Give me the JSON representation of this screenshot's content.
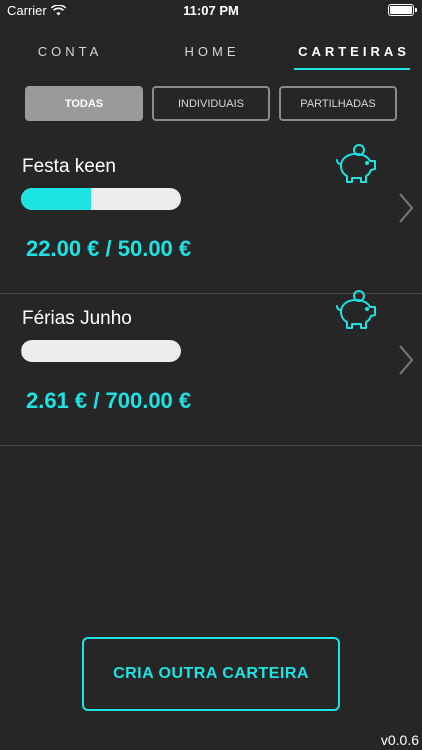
{
  "status_bar": {
    "carrier": "Carrier",
    "time": "11:07 PM"
  },
  "tabs": [
    {
      "label": "CONTA",
      "active": false
    },
    {
      "label": "HOME",
      "active": false
    },
    {
      "label": "CARTEIRAS",
      "active": true
    }
  ],
  "filters": [
    {
      "label": "TODAS",
      "active": true
    },
    {
      "label": "INDIVIDUAIS",
      "active": false
    },
    {
      "label": "PARTILHADAS",
      "active": false
    }
  ],
  "wallets": [
    {
      "name": "Festa keen",
      "amount": "22.00 € / 50.00 €",
      "progress": 0.44
    },
    {
      "name": "Férias Junho",
      "amount": "2.61 € / 700.00 €",
      "progress": 0.0037
    }
  ],
  "create_button": {
    "label": "CRIA OUTRA CARTEIRA"
  },
  "version": "v0.0.6",
  "colors": {
    "accent": "#1ee3e3",
    "background": "#262626"
  },
  "icons": {
    "wallet": "piggy-bank-icon",
    "row_arrow": "chevron-right-icon",
    "wifi": "wifi-icon",
    "battery": "battery-icon"
  }
}
